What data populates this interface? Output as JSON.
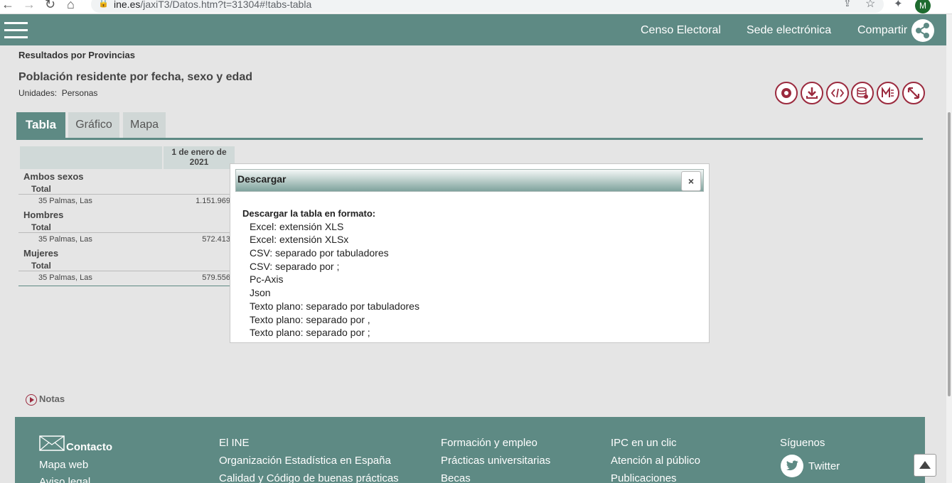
{
  "browser": {
    "url_host": "ine.es",
    "url_path": "/jaxiT3/Datos.htm?t=31304#!tabs-tabla",
    "profile_initial": "M"
  },
  "header": {
    "links": [
      "Censo Electoral",
      "Sede electrónica",
      "Compartir"
    ]
  },
  "page": {
    "subtitle": "Resultados por Provincias",
    "title": "Población residente por fecha, sexo y edad",
    "units_label": "Unidades:",
    "units_value": "Personas"
  },
  "tabs": [
    "Tabla",
    "Gráfico",
    "Mapa"
  ],
  "table": {
    "column_header": "1 de enero de 2021",
    "groups": [
      {
        "name": "Ambos sexos",
        "sub": "Total",
        "province": "35 Palmas, Las",
        "value": "1.151.969"
      },
      {
        "name": "Hombres",
        "sub": "Total",
        "province": "35 Palmas, Las",
        "value": "572.413"
      },
      {
        "name": "Mujeres",
        "sub": "Total",
        "province": "35 Palmas, Las",
        "value": "579.556"
      }
    ]
  },
  "dialog": {
    "title": "Descargar",
    "close": "×",
    "heading": "Descargar la tabla en formato:",
    "options": [
      "Excel: extensión XLS",
      "Excel: extensión XLSx",
      "CSV: separado por tabuladores",
      "CSV: separado por ;",
      "Pc-Axis",
      "Json",
      "Texto plano: separado por tabuladores",
      "Texto plano: separado por ,",
      "Texto plano: separado por ;"
    ]
  },
  "notas": "Notas",
  "footer": {
    "col1": [
      "Contacto",
      "Mapa web",
      "Aviso legal"
    ],
    "col2": [
      "El INE",
      "Organización Estadística en España",
      "Calidad y Código de buenas prácticas"
    ],
    "col3": [
      "Formación y empleo",
      "Prácticas universitarias",
      "Becas"
    ],
    "col4": [
      "IPC en un clic",
      "Atención al público",
      "Publicaciones"
    ],
    "col5": [
      "Síguenos",
      "Twitter"
    ]
  },
  "colors": {
    "header": "#5e8a84",
    "accent": "#9b2a3e"
  }
}
